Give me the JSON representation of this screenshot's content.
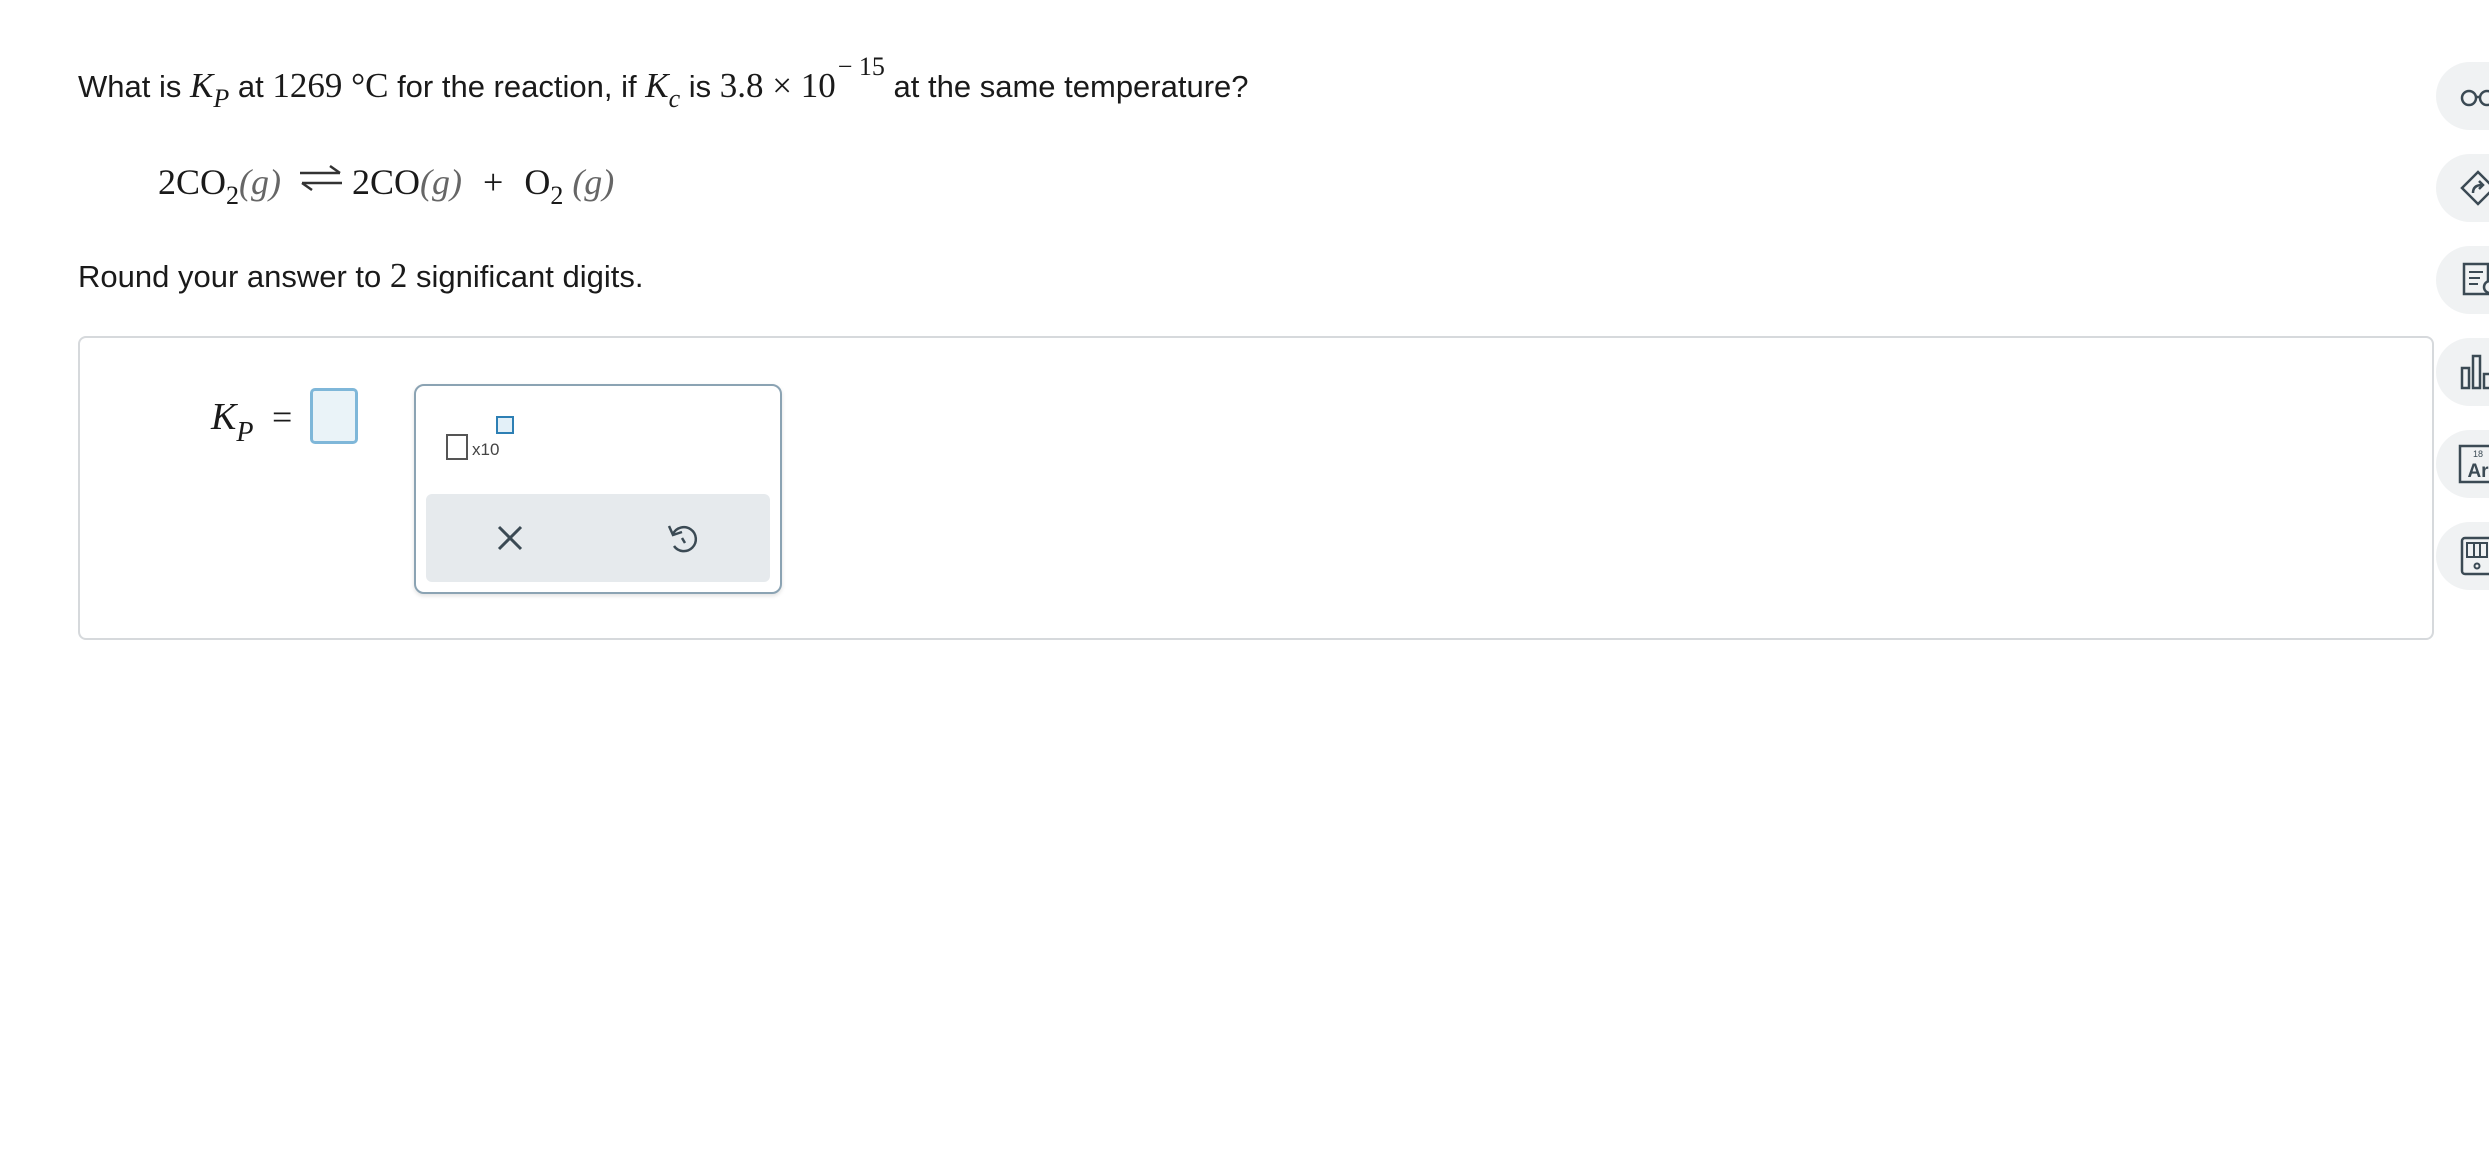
{
  "question": {
    "prefix": "What is",
    "k_symbol": "K",
    "k_p_sub": "P",
    "at": "at",
    "temperature": "1269 °C",
    "for_text": "for the reaction, if",
    "kc_symbol": "K",
    "kc_sub": "c",
    "is": "is",
    "kc_mantissa": "3.8 × 10",
    "kc_exponent": "− 15",
    "suffix": "at the same temperature?"
  },
  "equation": {
    "lhs_coef": "2",
    "lhs_species": "CO",
    "lhs_sub": "2",
    "lhs_state": "(g)",
    "rhs1_species": "2CO",
    "rhs1_state": "(g)",
    "plus": "+",
    "rhs2_species": "O",
    "rhs2_sub": "2",
    "rhs2_state": "(g)"
  },
  "instructions": {
    "prefix": "Round your answer to",
    "digits": "2",
    "suffix": "significant digits."
  },
  "answer": {
    "label_symbol": "K",
    "label_sub": "P",
    "equals": "=",
    "value": ""
  },
  "palette": {
    "sci_label": "x10",
    "clear_icon": "close-icon",
    "undo_icon": "undo-icon"
  },
  "toolbar": {
    "icons": [
      "glasses-icon",
      "tag-arrow-icon",
      "notes-lightbulb-icon",
      "bar-chart-icon",
      "periodic-table-icon",
      "calculator-icon"
    ],
    "periodic_number": "18",
    "periodic_symbol": "Ar"
  },
  "colors": {
    "input_border": "#7fb7d9",
    "input_fill": "#eaf3f8",
    "palette_bar": "#e6eaed",
    "tool_bg": "#f0f2f3",
    "icon_stroke": "#3b4a54"
  }
}
